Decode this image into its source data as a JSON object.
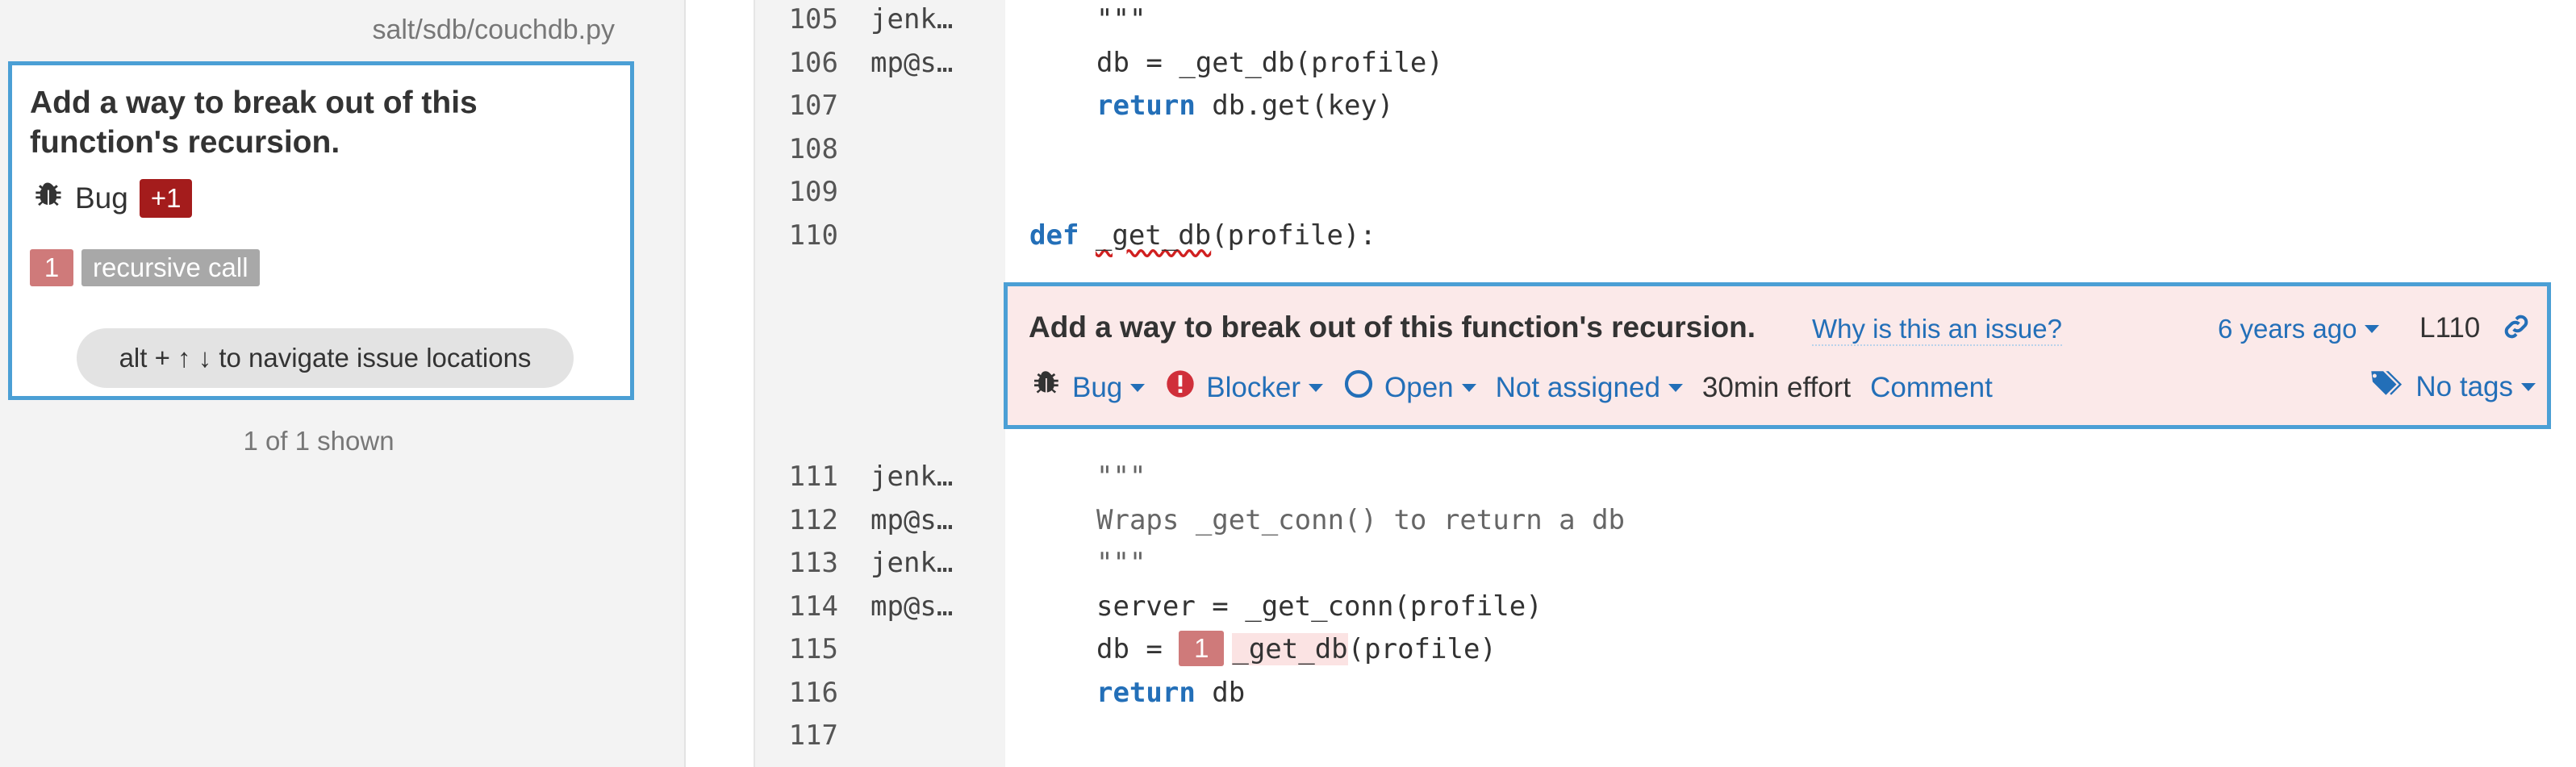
{
  "sidebar": {
    "file_path": "salt/sdb/couchdb.py",
    "issue": {
      "title": "Add a way to break out of this function's recursion.",
      "type": "Bug",
      "plus_badge": "+1",
      "location_number": "1",
      "location_message": "recursive call",
      "nav_hint": "alt + ↑ ↓ to navigate issue locations"
    },
    "shown_count": "1 of 1 shown"
  },
  "code_lines": [
    {
      "ln": "105",
      "author": "jenk…",
      "code": "\"\"\""
    },
    {
      "ln": "106",
      "author": "mp@s…",
      "code": "db = _get_db(profile)"
    },
    {
      "ln": "107",
      "author": "",
      "kw": "return",
      "code": " db.get(key)"
    },
    {
      "ln": "108",
      "author": "",
      "code": ""
    },
    {
      "ln": "109",
      "author": "",
      "code": ""
    },
    {
      "ln": "110",
      "author": "",
      "kw": "def",
      "fn": "_get_db",
      "code": "(profile):"
    },
    {
      "ln": "111",
      "author": "jenk…",
      "code": "\"\"\""
    },
    {
      "ln": "112",
      "author": "mp@s…",
      "code": "Wraps _get_conn() to return a db"
    },
    {
      "ln": "113",
      "author": "jenk…",
      "code": "\"\"\""
    },
    {
      "ln": "114",
      "author": "mp@s…",
      "code": "server = _get_conn(profile)"
    },
    {
      "ln": "115",
      "author": "",
      "pre": "db = ",
      "marker": "1",
      "fn": "_get_db",
      "code": "(profile)"
    },
    {
      "ln": "116",
      "author": "",
      "kw": "return",
      "code": " db"
    },
    {
      "ln": "117",
      "author": "",
      "code": ""
    }
  ],
  "issue_box": {
    "title": "Add a way to break out of this function's recursion.",
    "why_link": "Why is this an issue?",
    "age": "6 years ago",
    "line_ref": "L110",
    "type": "Bug",
    "severity": "Blocker",
    "status": "Open",
    "assignee": "Not assigned",
    "effort": "30min effort",
    "comment": "Comment",
    "tags": "No tags"
  },
  "colors": {
    "accent": "#4b9fd5",
    "link": "#236fb8",
    "blocker": "#d02f3a",
    "badge_red": "#a41c1c",
    "location_marker": "#cf7a7a",
    "issue_bg": "#fbe9e9"
  },
  "icons": [
    "bug-icon",
    "blocker-icon",
    "open-status-icon",
    "tag-icon",
    "permalink-icon",
    "caret-down-icon"
  ]
}
